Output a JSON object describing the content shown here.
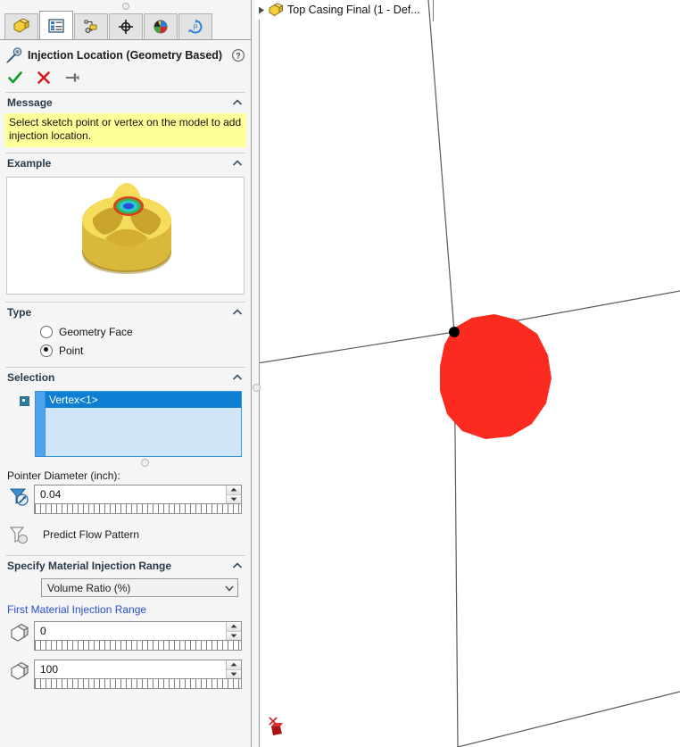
{
  "panel": {
    "tabs": [
      {
        "name": "feature-manager-tree",
        "icon": "part-yellow-icon",
        "active": false
      },
      {
        "name": "property-manager",
        "icon": "property-list-icon",
        "active": true
      },
      {
        "name": "configuration-manager",
        "icon": "configuration-icon",
        "active": false
      },
      {
        "name": "dimxpert-manager",
        "icon": "crosshair-target-icon",
        "active": false
      },
      {
        "name": "display-manager",
        "icon": "color-sphere-icon",
        "active": false
      },
      {
        "name": "plastics-manager",
        "icon": "plastics-recycle-p-icon",
        "active": false
      }
    ],
    "title": "Injection Location (Geometry Based)",
    "title_icon": "injection-nozzle-icon",
    "help_icon": "help-question-icon",
    "commands": [
      {
        "name": "ok-button",
        "icon": "green-check-icon",
        "label": "OK"
      },
      {
        "name": "cancel-button",
        "icon": "red-x-icon",
        "label": "Cancel"
      },
      {
        "name": "pin-button",
        "icon": "pushpin-icon",
        "label": "Keep Visible"
      }
    ],
    "message": {
      "heading": "Message",
      "text": "Select sketch point or vertex on the model to add injection location.",
      "background": "#ffff99"
    },
    "example": {
      "heading": "Example",
      "image_alt": "yellow molded part with colored injection spot"
    },
    "type": {
      "heading": "Type",
      "options": [
        {
          "label": "Geometry Face",
          "selected": false
        },
        {
          "label": "Point",
          "selected": true
        }
      ]
    },
    "selection": {
      "heading": "Selection",
      "items": [
        "Vertex<1>"
      ],
      "selected_index": 0
    },
    "pointer_diameter": {
      "label": "Pointer Diameter (inch):",
      "value": "0.04",
      "icon": "pointer-diameter-funnel-icon"
    },
    "predict_flow": {
      "label": "Predict Flow Pattern",
      "icon": "flow-pattern-funnel-icon"
    },
    "material_range": {
      "heading": "Specify Material Injection Range",
      "dropdown_value": "Volume Ratio (%)",
      "dropdown_options": [
        "Volume Ratio (%)"
      ],
      "link_label": "First Material Injection Range",
      "link_color": "#2a4fd6",
      "first_value": "0",
      "second_value": "100",
      "row_icon": "part-solid-icon"
    }
  },
  "viewport": {
    "tree_item": {
      "label": "Top Casing Final  (1 - Def...",
      "icon": "part-yellow-icon",
      "expand_icon": "triangle-right-icon"
    },
    "injection_marker": {
      "name": "injection-location-marker",
      "color": "#fc2b20",
      "vertex_color": "#000000"
    },
    "origin_triad": {
      "name": "origin-triad-icon",
      "color": "#b01818"
    },
    "edge_color": "#5a5a5a",
    "background": "#ffffff"
  }
}
